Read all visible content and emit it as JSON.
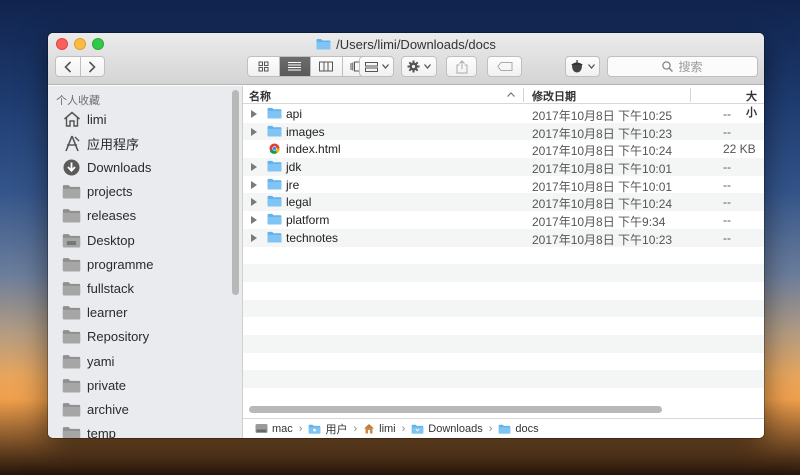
{
  "window": {
    "title": "/Users/limi/Downloads/docs"
  },
  "toolbar": {
    "back_icon": "chevron-left-icon",
    "forward_icon": "chevron-right-icon",
    "view_icons": [
      "grid-view-icon",
      "list-view-icon",
      "column-view-icon",
      "coverflow-view-icon"
    ],
    "arrange_icon": "arrange-icon",
    "action_icon": "gear-icon",
    "share_icon": "share-icon",
    "tag_icon": "tag-icon",
    "app_icon": "acorn-icon",
    "search_placeholder": "搜索"
  },
  "sidebar": {
    "heading": "个人收藏",
    "items": [
      {
        "label": "limi",
        "icon": "home-icon"
      },
      {
        "label": "应用程序",
        "icon": "applications-icon"
      },
      {
        "label": "Downloads",
        "icon": "download-icon"
      },
      {
        "label": "projects",
        "icon": "folder-icon"
      },
      {
        "label": "releases",
        "icon": "folder-icon"
      },
      {
        "label": "Desktop",
        "icon": "desktop-folder-icon"
      },
      {
        "label": "programme",
        "icon": "folder-icon"
      },
      {
        "label": "fullstack",
        "icon": "folder-icon"
      },
      {
        "label": "learner",
        "icon": "folder-icon"
      },
      {
        "label": "Repository",
        "icon": "folder-icon"
      },
      {
        "label": "yami",
        "icon": "folder-icon"
      },
      {
        "label": "private",
        "icon": "folder-icon"
      },
      {
        "label": "archive",
        "icon": "folder-icon"
      },
      {
        "label": "temp",
        "icon": "folder-icon"
      }
    ]
  },
  "columns": {
    "name": "名称",
    "modified": "修改日期",
    "size": "大小"
  },
  "files": [
    {
      "name": "api",
      "modified": "2017年10月8日 下午10:25",
      "size": "--",
      "kind": "folder"
    },
    {
      "name": "images",
      "modified": "2017年10月8日 下午10:23",
      "size": "--",
      "kind": "folder"
    },
    {
      "name": "index.html",
      "modified": "2017年10月8日 下午10:24",
      "size": "22 KB",
      "kind": "chrome-html"
    },
    {
      "name": "jdk",
      "modified": "2017年10月8日 下午10:01",
      "size": "--",
      "kind": "folder"
    },
    {
      "name": "jre",
      "modified": "2017年10月8日 下午10:01",
      "size": "--",
      "kind": "folder"
    },
    {
      "name": "legal",
      "modified": "2017年10月8日 下午10:24",
      "size": "--",
      "kind": "folder"
    },
    {
      "name": "platform",
      "modified": "2017年10月8日 下午9:34",
      "size": "--",
      "kind": "folder"
    },
    {
      "name": "technotes",
      "modified": "2017年10月8日 下午10:23",
      "size": "--",
      "kind": "folder"
    }
  ],
  "pathbar": [
    {
      "label": "mac",
      "icon": "disk-icon"
    },
    {
      "label": "用户",
      "icon": "users-folder-icon"
    },
    {
      "label": "limi",
      "icon": "home-icon"
    },
    {
      "label": "Downloads",
      "icon": "download-folder-icon"
    },
    {
      "label": "docs",
      "icon": "folder-icon"
    }
  ],
  "colors": {
    "folder": "#5fb2ec",
    "sidebar_bg": "#e9ebee",
    "selected_view": "#5f5f5f"
  }
}
